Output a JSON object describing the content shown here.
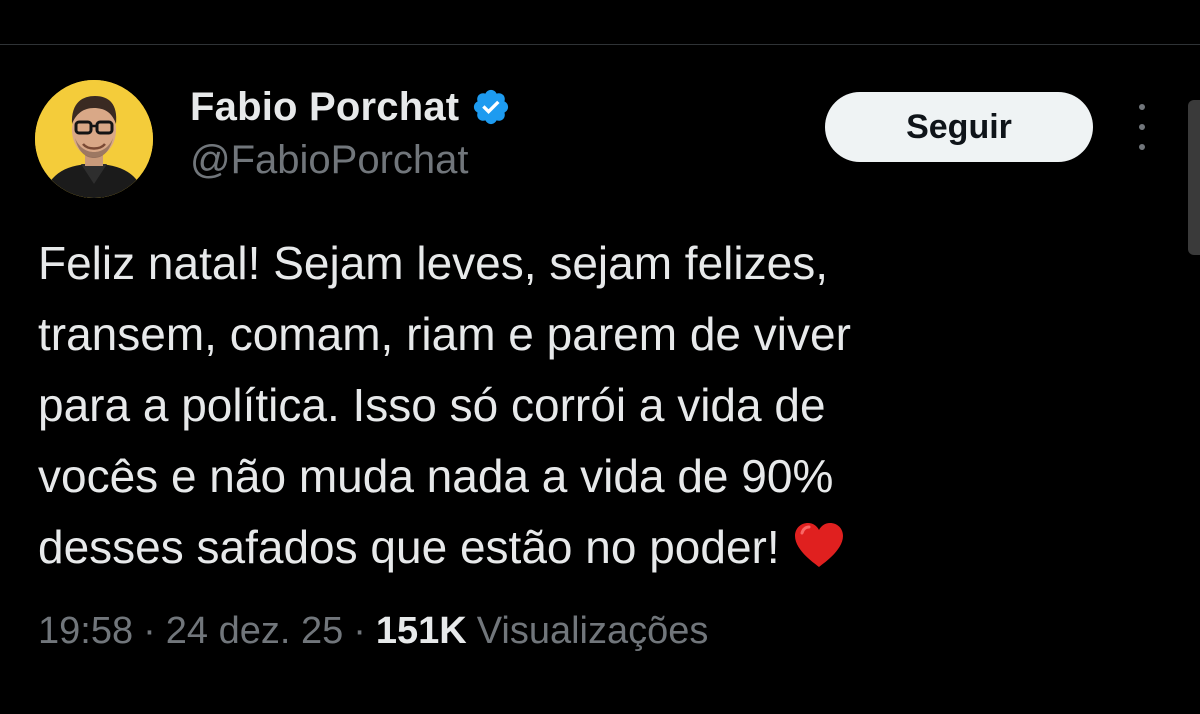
{
  "author": {
    "display_name": "Fabio Porchat",
    "handle": "@FabioPorchat",
    "verified": true,
    "avatar_bg": "#f4cc3a"
  },
  "follow_button": {
    "label": "Seguir"
  },
  "more_menu": {
    "icon": "more-vertical-icon"
  },
  "tweet": {
    "lines": [
      "Feliz natal! Sejam leves, sejam felizes,",
      "transem, comam, riam e parem de viver",
      "para a política. Isso só corrói a vida de",
      "vocês e não muda nada a vida de 90%",
      "desses safados que estão no poder!"
    ],
    "emoji": "heart-icon"
  },
  "meta": {
    "time": "19:58",
    "separator": "·",
    "date": "24 dez. 25",
    "views_count": "151K",
    "views_label": "Visualizações"
  },
  "colors": {
    "background": "#000000",
    "text": "#e7e9ea",
    "muted": "#71767b",
    "verified_blue": "#1d9bf0",
    "heart_red": "#e0201f"
  }
}
